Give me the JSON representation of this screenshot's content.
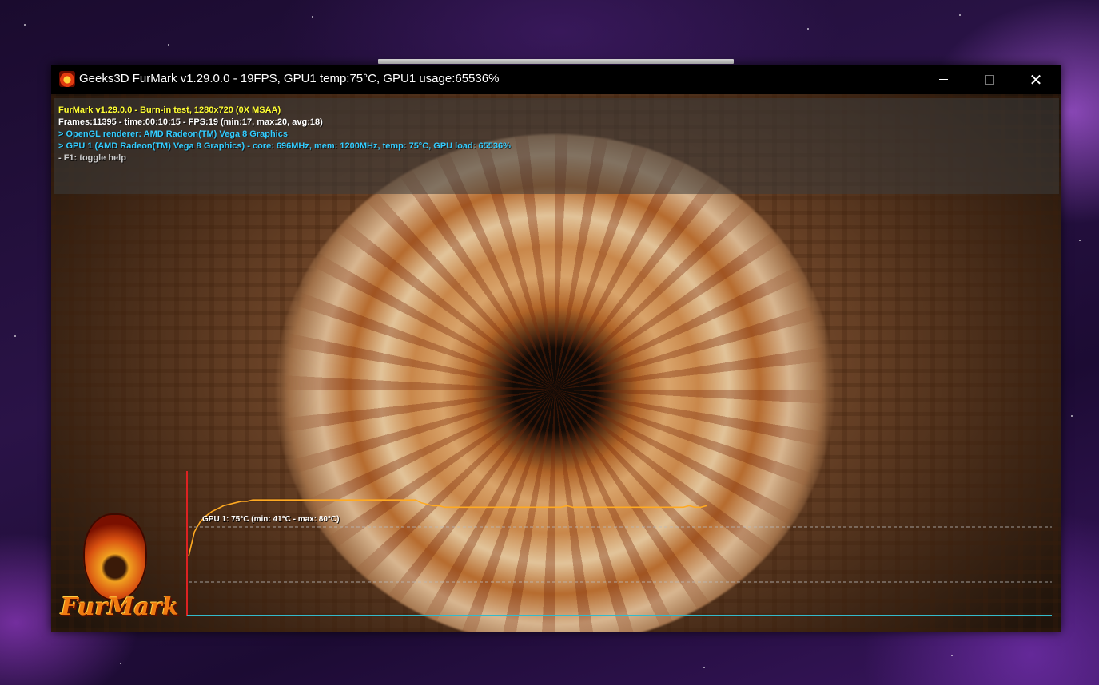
{
  "window": {
    "title": "Geeks3D FurMark v1.29.0.0 - 19FPS, GPU1 temp:75°C, GPU1 usage:65536%",
    "icon": "furmark-app-icon",
    "controls": {
      "minimize": "minimize-icon",
      "maximize": "maximize-icon",
      "close": "close-icon",
      "close_glyph": "✕"
    }
  },
  "hud": {
    "line1": "FurMark v1.29.0.0 - Burn-in test, 1280x720 (0X MSAA)",
    "line2": "Frames:11395 - time:00:10:15 - FPS:19 (min:17, max:20, avg:18)",
    "line3": "> OpenGL renderer: AMD Radeon(TM) Vega 8 Graphics",
    "line4": "> GPU 1 (AMD Radeon(TM) Vega 8 Graphics) - core: 696MHz, mem: 1200MHz, temp: 75°C, GPU load: 65536%",
    "line5": "- F1: toggle help"
  },
  "logo": {
    "text": "FurMark"
  },
  "colors": {
    "hud_title": "#ffff33",
    "hud_stats": "#ffffff",
    "hud_info": "#33ccff",
    "hud_help": "#cccccc",
    "graph_line": "#ffaa22",
    "graph_axis_x": "#33bbcc",
    "graph_axis_y": "#dd2222"
  },
  "temperature_graph": {
    "label": "GPU 1: 75°C (min: 41°C - max: 80°C)",
    "min": 41,
    "max": 80,
    "current": 75
  },
  "chart_data": {
    "type": "line",
    "title": "GPU 1: 75°C (min: 41°C - max: 80°C)",
    "xlabel": "",
    "ylabel": "",
    "ylim": [
      0,
      100
    ],
    "grid": true,
    "series": [
      {
        "name": "GPU 1",
        "values": [
          41,
          58,
          65,
          69,
          72,
          74,
          76,
          77,
          78,
          79,
          79,
          80,
          80,
          80,
          80,
          80,
          80,
          80,
          80,
          80,
          80,
          80,
          80,
          80,
          80,
          80,
          80,
          80,
          80,
          80,
          80,
          80,
          80,
          80,
          80,
          80,
          80,
          80,
          80,
          80,
          78,
          77,
          76,
          76,
          75,
          75,
          75,
          75,
          75,
          75,
          75,
          75,
          75,
          75,
          75,
          75,
          75,
          75,
          75,
          75,
          75,
          75,
          75,
          75,
          75,
          76,
          75,
          75,
          75,
          75,
          75,
          75,
          75,
          75,
          75,
          75,
          75,
          75,
          75,
          75,
          75,
          75,
          75,
          75,
          75,
          75,
          76,
          75,
          75,
          76
        ]
      }
    ]
  }
}
